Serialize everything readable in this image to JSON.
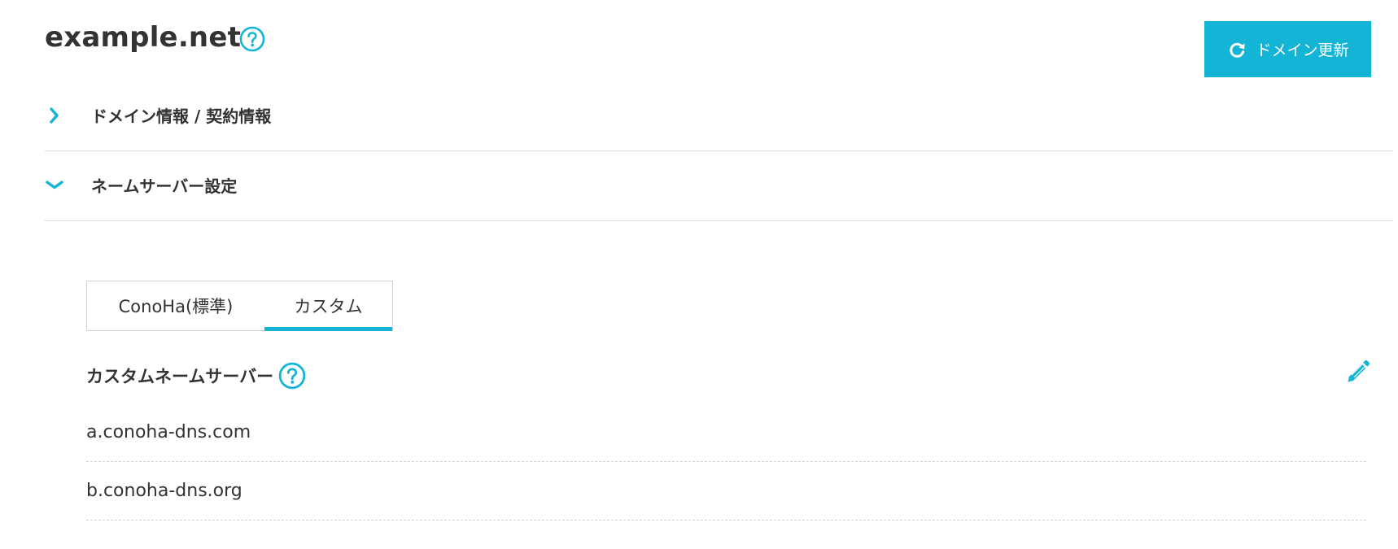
{
  "header": {
    "domain_name": "example.net",
    "help_icon": "question-circle-icon",
    "renew_button_label": "ドメイン更新",
    "renew_icon": "redo-arrow-icon"
  },
  "sections": [
    {
      "label": "ドメイン情報 / 契約情報",
      "expanded": false,
      "icon": "chevron-right-icon"
    },
    {
      "label": "ネームサーバー設定",
      "expanded": true,
      "icon": "chevron-down-icon"
    }
  ],
  "tabs": [
    {
      "label": "ConoHa(標準)",
      "active": false
    },
    {
      "label": "カスタム",
      "active": true
    }
  ],
  "custom_ns": {
    "heading": "カスタムネームサーバー",
    "help_icon": "question-circle-icon",
    "edit_icon": "pencil-icon",
    "servers": [
      "a.conoha-dns.com",
      "b.conoha-dns.org"
    ]
  },
  "colors": {
    "accent": "#14b4d6",
    "text": "#333333",
    "divider": "#dcdcdc"
  }
}
